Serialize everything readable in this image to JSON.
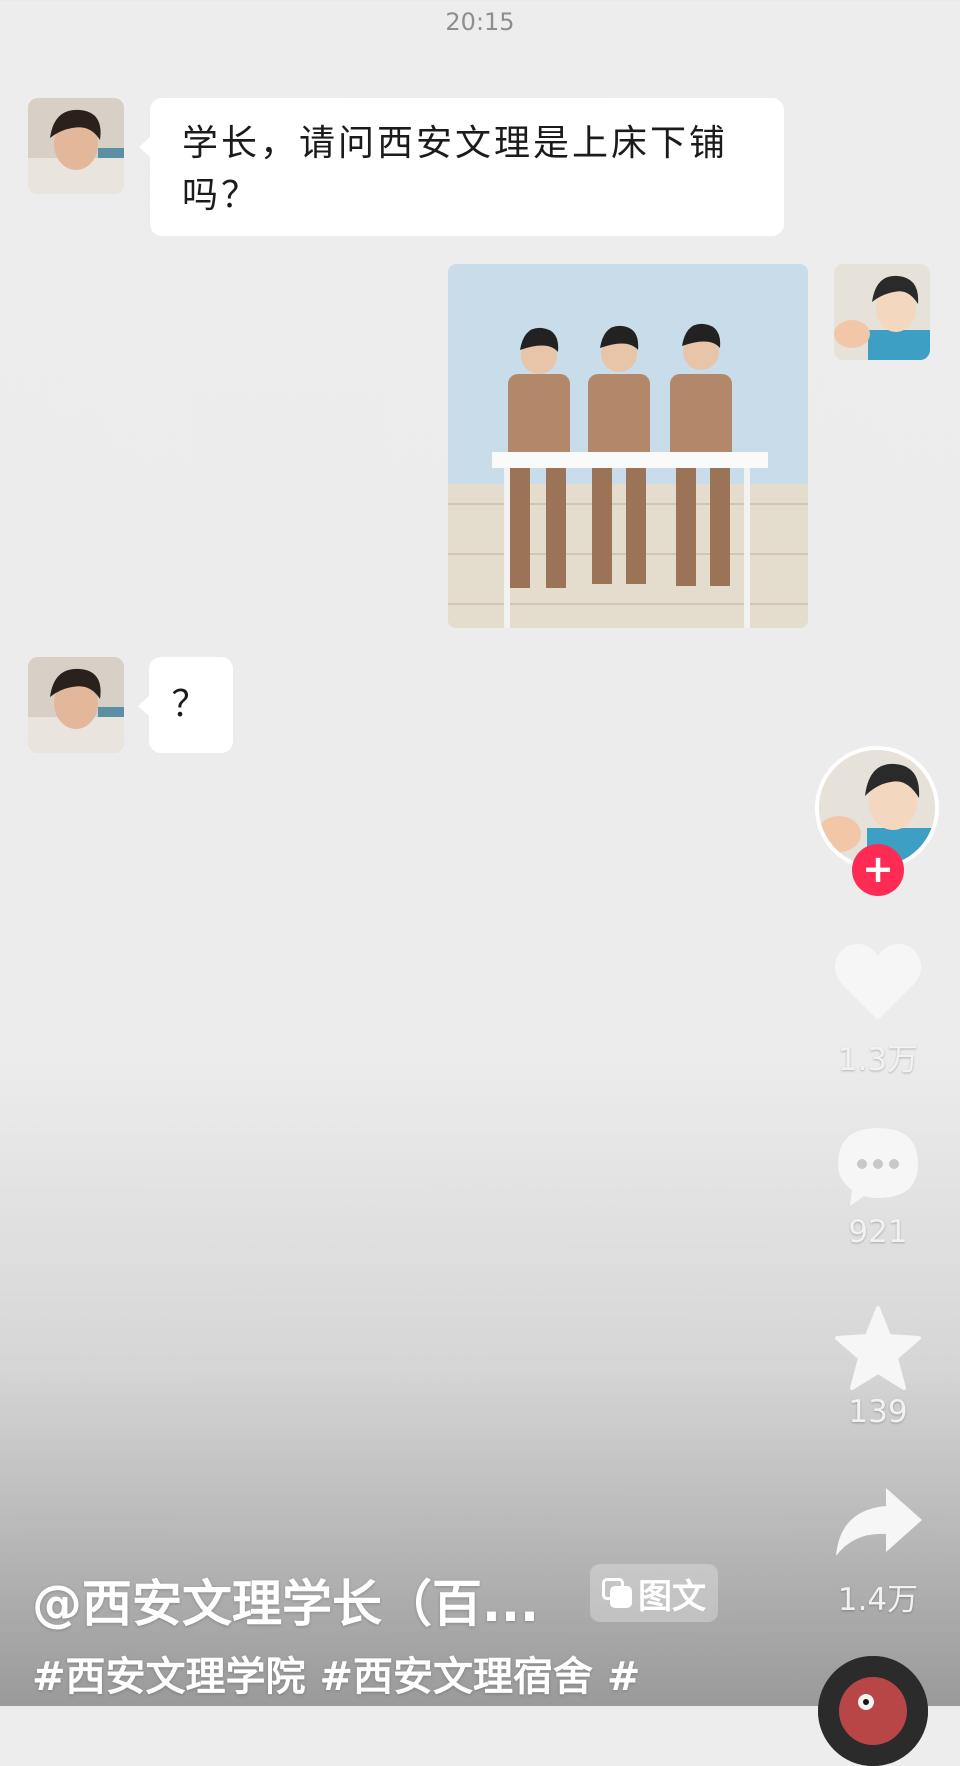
{
  "chat": {
    "time": "20:15",
    "messages": [
      {
        "side": "left",
        "text": "学长，请问西安文理是上床下铺吗？"
      },
      {
        "side": "right",
        "type": "image",
        "icon": "photo-three-boys-at-table"
      },
      {
        "side": "left",
        "text": "？"
      }
    ]
  },
  "sidebar": {
    "like_count": "1.3万",
    "comment_count": "921",
    "favorite_count": "139",
    "share_count": "1.4万"
  },
  "post": {
    "author": "@西安文理学长（百...",
    "badge_label": "图文",
    "hashtags": "#西安文理学院 #西安文理宿舍 #"
  },
  "colors": {
    "follow_button": "#fe2c55",
    "bubble": "#ffffff",
    "background": "#ededed"
  }
}
